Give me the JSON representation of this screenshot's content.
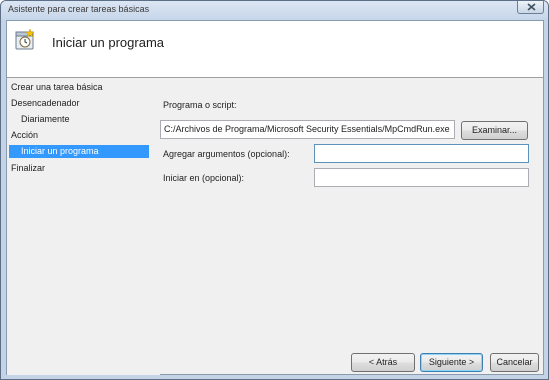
{
  "window": {
    "title": "Asistente para crear tareas básicas"
  },
  "header": {
    "title": "Iniciar un programa",
    "icon": "task-clock-icon"
  },
  "nav": {
    "items": [
      {
        "label": "Crear una tarea básica",
        "selected": false
      },
      {
        "label": "Desencadenador",
        "selected": false
      },
      {
        "label": "Diariamente",
        "selected": false
      },
      {
        "label": "Acción",
        "selected": false
      },
      {
        "label": "Iniciar un programa",
        "selected": true
      },
      {
        "label": "Finalizar",
        "selected": false
      }
    ]
  },
  "form": {
    "program_label": "Programa o script:",
    "program_value": "C:/Archivos de Programa/Microsoft Security Essentials/MpCmdRun.exe",
    "browse_button": "Examinar...",
    "args_label": "Agregar argumentos (opcional):",
    "args_value": "",
    "startin_label": "Iniciar en (opcional):",
    "startin_value": ""
  },
  "footer": {
    "back_button": "< Atrás",
    "next_button": "Siguiente >",
    "cancel_button": "Cancelar"
  },
  "colors": {
    "selection": "#3399ff",
    "window_frame": "#c4d3e6"
  }
}
